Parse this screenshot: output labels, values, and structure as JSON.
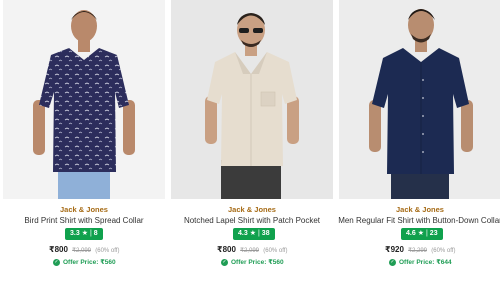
{
  "products": [
    {
      "brand": "Jack & Jones",
      "title": "Bird Print Shirt with Spread Collar",
      "rating": "3.3",
      "star": "★",
      "reviews": "8",
      "price": "₹800",
      "mrp": "₹2,099",
      "discount": "(60% off)",
      "offer": "Offer Price: ₹560",
      "shirt_color": "#2c2d5c",
      "image": "product-photo-bird-print-shirt"
    },
    {
      "brand": "Jack & Jones",
      "title": "Notched Lapel Shirt with Patch Pocket",
      "rating": "4.3",
      "star": "★",
      "reviews": "38",
      "price": "₹800",
      "mrp": "₹2,099",
      "discount": "(60% off)",
      "offer": "Offer Price: ₹560",
      "shirt_color": "#e6ddcf",
      "image": "product-photo-notched-lapel-shirt"
    },
    {
      "brand": "Jack & Jones",
      "title": "Men Regular Fit Shirt with Button-Down Collar",
      "rating": "4.6",
      "star": "★",
      "reviews": "23",
      "price": "₹920",
      "mrp": "₹2,299",
      "discount": "(60% off)",
      "offer": "Offer Price: ₹644",
      "shirt_color": "#1c2a52",
      "image": "product-photo-button-down-shirt"
    }
  ],
  "colors": {
    "brand_text": "#a66b16",
    "rating_bg": "#10a14d",
    "offer_text": "#1f9d55"
  },
  "icons": {
    "offer": "check-circle-icon",
    "rating": "star-icon"
  }
}
